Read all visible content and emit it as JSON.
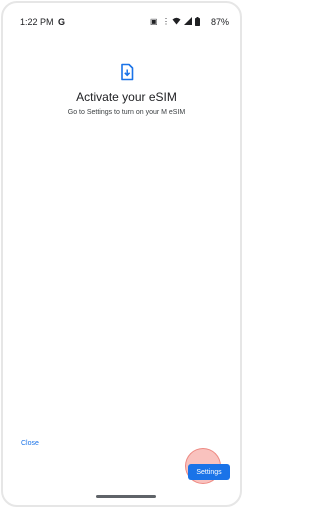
{
  "status_bar": {
    "time": "1:22 PM",
    "app_notification": "G",
    "battery_percent": "87%",
    "icons": [
      "nfc-icon",
      "vibrate-icon",
      "wifi-icon",
      "signal-icon",
      "battery-icon"
    ]
  },
  "main": {
    "icon": "sim-download-icon",
    "title": "Activate your eSIM",
    "subtitle": "Go to Settings to turn on your M eSIM"
  },
  "actions": {
    "close_label": "Close",
    "settings_label": "Settings"
  },
  "colors": {
    "accent": "#1a73e8",
    "text_primary": "#202124",
    "touch_indicator": "#f48f88"
  }
}
